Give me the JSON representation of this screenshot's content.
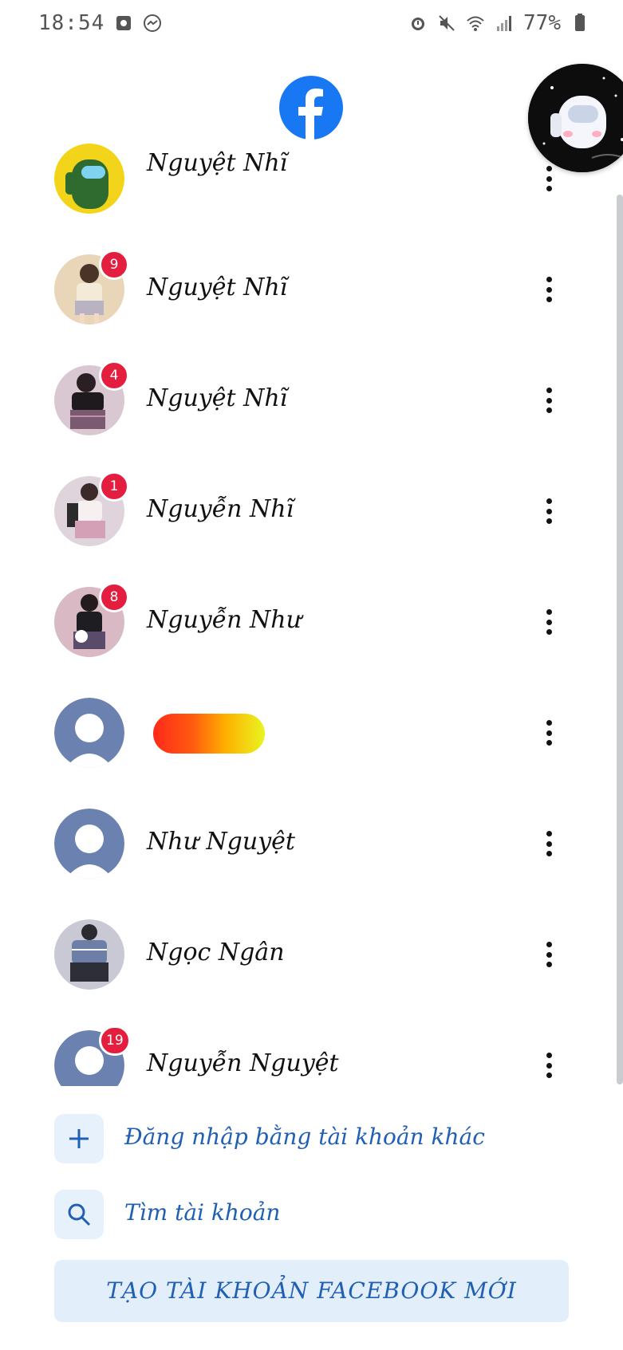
{
  "status_bar": {
    "time": "18:54",
    "battery_percent": "77%",
    "left_icons": [
      "photo-notification-icon",
      "messenger-notification-icon"
    ],
    "right_icons": [
      "alarm-icon",
      "mute-icon",
      "wifi-icon",
      "signal-icon",
      "battery-icon"
    ]
  },
  "header": {
    "logo_icon": "facebook-logo-icon",
    "brand_color": "#1877f2"
  },
  "accounts": [
    {
      "name": "Nguyệt Nhĩ",
      "badge": ""
    },
    {
      "name": "Nguyệt Nhĩ",
      "badge": "9"
    },
    {
      "name": "Nguyệt Nhĩ",
      "badge": "4"
    },
    {
      "name": "Nguyễn Nhĩ",
      "badge": "1"
    },
    {
      "name": "Nguyễn Như",
      "badge": "8"
    },
    {
      "name": "",
      "badge": "",
      "redacted": true
    },
    {
      "name": "Như Nguyệt",
      "badge": ""
    },
    {
      "name": "Ngọc Ngân",
      "badge": ""
    },
    {
      "name": "Nguyễn Nguyệt",
      "badge": "19"
    }
  ],
  "actions": {
    "login_other": "Đăng nhập bằng tài khoản khác",
    "find_account": "Tìm tài khoản",
    "create_account": "TẠO TÀI KHOẢN FACEBOOK MỚI"
  },
  "colors": {
    "badge": "#e41e3f",
    "link_text": "#1f5fb4",
    "button_bg": "#e3eefb",
    "default_avatar": "#6b81b0"
  }
}
